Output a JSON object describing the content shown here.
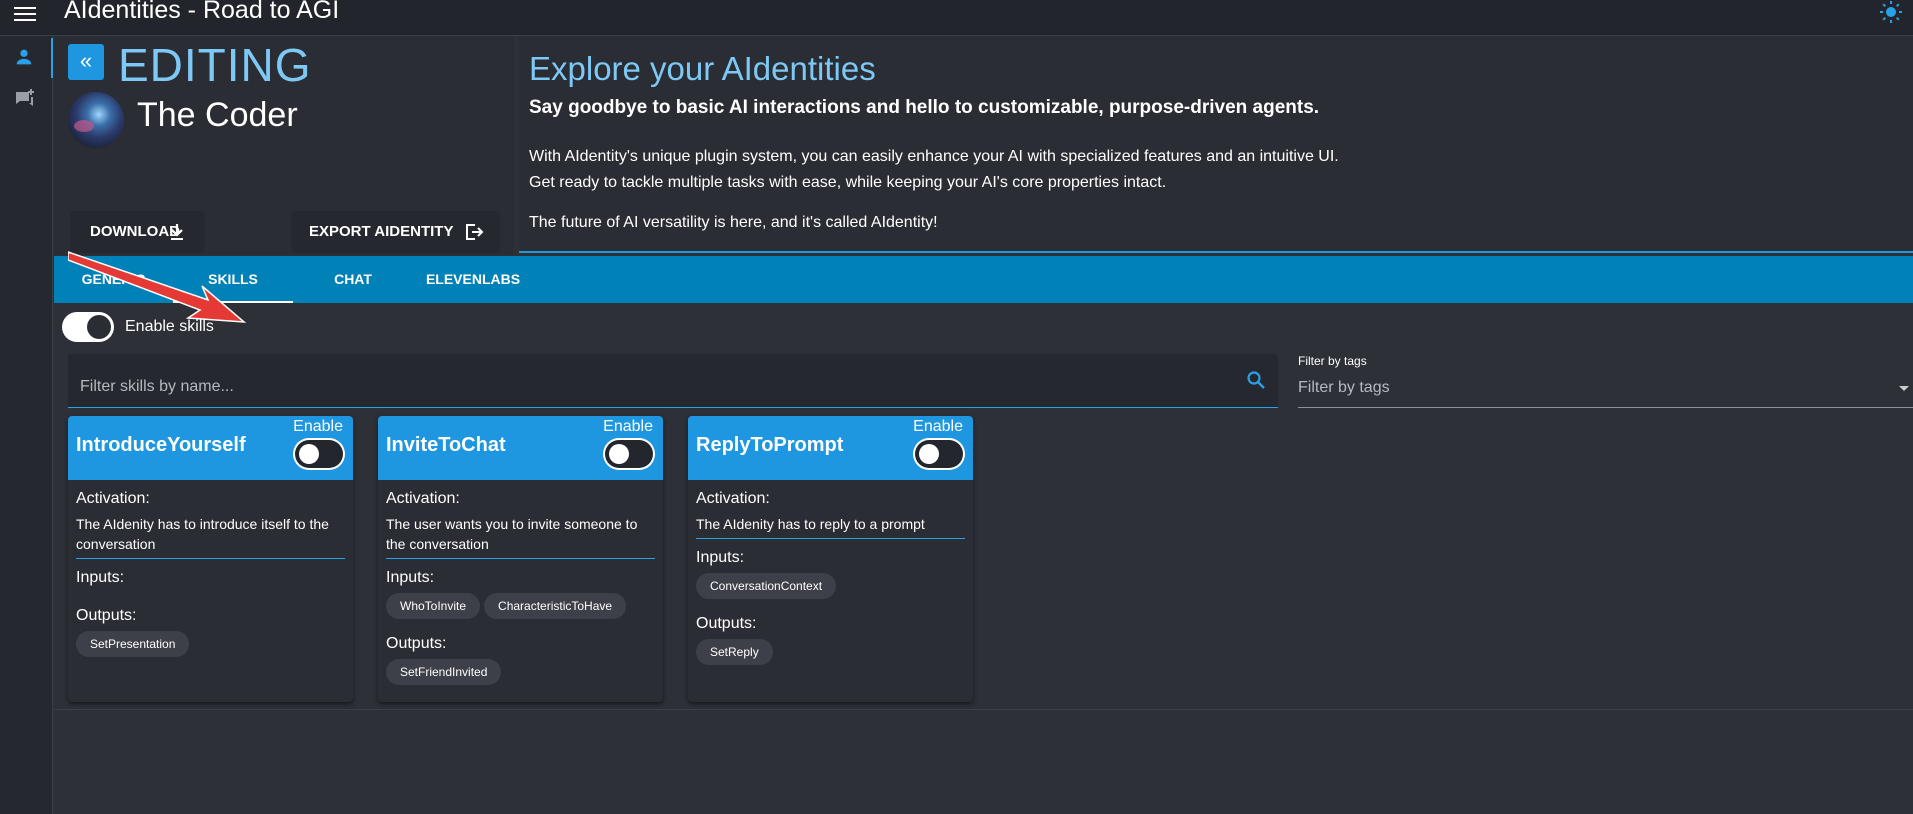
{
  "app": {
    "title": "AIdentities - Road to AGI",
    "accent_color": "#1e96e0"
  },
  "topbar": {
    "menu_icon": "menu-icon",
    "theme_icon": "sun-icon"
  },
  "sidebar": {
    "items": [
      {
        "icon": "person-icon",
        "active": true
      },
      {
        "icon": "chat-add-icon",
        "active": false
      }
    ]
  },
  "editor": {
    "heading": "EDITING",
    "back_icon": "double-chevron-left-icon",
    "identity_name": "The Coder",
    "download_label": "DOWNLOAD",
    "export_label": "EXPORT AIDENTITY"
  },
  "explore": {
    "title": "Explore your AIdentities",
    "subtitle": "Say goodbye to basic AI interactions and hello to customizable, purpose-driven agents.",
    "paragraph1": "With AIdentity's unique plugin system, you can easily enhance your AI with specialized features and an intuitive UI.",
    "paragraph2": "Get ready to tackle multiple tasks with ease, while keeping your AI's core properties intact.",
    "paragraph3": "The future of AI versatility is here, and it's called AIdentity!"
  },
  "tabs": [
    {
      "label": "GENERIC",
      "active": false
    },
    {
      "label": "SKILLS",
      "active": true
    },
    {
      "label": "CHAT",
      "active": false
    },
    {
      "label": "ELEVENLABS",
      "active": false
    }
  ],
  "skills": {
    "enable_label": "Enable skills",
    "search_placeholder": "Filter skills by name...",
    "tags_label": "Filter by tags",
    "tags_placeholder": "Filter by tags",
    "activation_heading": "Activation:",
    "inputs_heading": "Inputs:",
    "outputs_heading": "Outputs:",
    "enable_toggle_label": "Enable",
    "cards": [
      {
        "name": "IntroduceYourself",
        "activation": "The AIdenity has to introduce itself to the conversation",
        "inputs": [],
        "outputs": [
          "SetPresentation"
        ]
      },
      {
        "name": "InviteToChat",
        "activation": "The user wants you to invite someone to the conversation",
        "inputs": [
          "WhoToInvite",
          "CharacteristicToHave"
        ],
        "outputs": [
          "SetFriendInvited"
        ]
      },
      {
        "name": "ReplyToPrompt",
        "activation": "The AIdenity has to reply to a prompt",
        "inputs": [
          "ConversationContext"
        ],
        "outputs": [
          "SetReply"
        ]
      }
    ]
  }
}
